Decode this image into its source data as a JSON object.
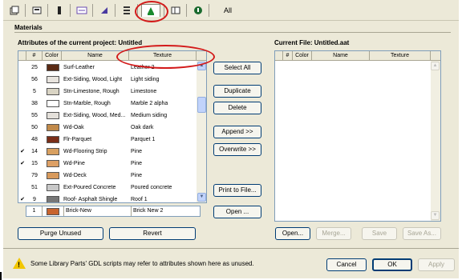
{
  "materials_title": "Materials",
  "left": {
    "title": "Attributes of the current project: Untitled",
    "columns": [
      "#",
      "Color",
      "Name",
      "Texture"
    ],
    "rows": [
      {
        "check": "",
        "num": "25",
        "color": "#5a2a14",
        "name": "Surf-Leather",
        "texture": "Leather 2"
      },
      {
        "check": "",
        "num": "56",
        "color": "#e8e4de",
        "name": "Ext-Siding, Wood, Light",
        "texture": "Light siding"
      },
      {
        "check": "",
        "num": "5",
        "color": "#d9d4c4",
        "name": "Stn-Limestone, Rough",
        "texture": "Limestone"
      },
      {
        "check": "",
        "num": "38",
        "color": "#ffffff",
        "name": "Stn-Marble, Rough",
        "texture": "Marble 2 alpha"
      },
      {
        "check": "",
        "num": "55",
        "color": "#e4e0da",
        "name": "Ext-Siding, Wood, Med...",
        "texture": "Medium siding"
      },
      {
        "check": "",
        "num": "50",
        "color": "#c18a4a",
        "name": "Wd-Oak",
        "texture": "Oak dark"
      },
      {
        "check": "",
        "num": "48",
        "color": "#7a2e18",
        "name": "Flr-Parquet",
        "texture": "Parquet 1"
      },
      {
        "check": "✔",
        "num": "14",
        "color": "#d8a060",
        "name": "Wd-Flooring Strip",
        "texture": "Pine"
      },
      {
        "check": "✔",
        "num": "15",
        "color": "#dda065",
        "name": "Wd-Pine",
        "texture": "Pine"
      },
      {
        "check": "",
        "num": "79",
        "color": "#d89a5c",
        "name": "Wd-Deck",
        "texture": "Pine"
      },
      {
        "check": "",
        "num": "51",
        "color": "#c8c8c8",
        "name": "Ext-Poured Concrete",
        "texture": "Poured concrete"
      },
      {
        "check": "✔",
        "num": "9",
        "color": "#777777",
        "name": "Roof- Asphalt Shingle",
        "texture": "Roof 1"
      }
    ],
    "edit_row": {
      "num": "1",
      "color": "#c8642e",
      "name": "Brick-New",
      "texture": "Brick New 2"
    }
  },
  "buttons": {
    "select_all": "Select All",
    "duplicate": "Duplicate",
    "delete": "Delete",
    "append": "Append >>",
    "overwrite": "Overwrite >>",
    "print": "Print to File...",
    "open_mid": "Open ...",
    "purge": "Purge Unused",
    "revert": "Revert",
    "open": "Open...",
    "merge": "Merge...",
    "save": "Save",
    "save_as": "Save As...",
    "cancel": "Cancel",
    "ok": "OK",
    "apply": "Apply"
  },
  "right": {
    "title": "Current File: Untitled.aat",
    "columns": [
      "#",
      "Color",
      "Name",
      "Texture"
    ]
  },
  "toolbar": {
    "all_label": "All"
  },
  "status": {
    "text": "Some Library Parts' GDL scripts may refer to attributes shown here as unused.",
    "mark": "!"
  },
  "colors": {
    "annotation_red": "#d31a1a",
    "active_tab_icon": "#1a8a2e"
  }
}
